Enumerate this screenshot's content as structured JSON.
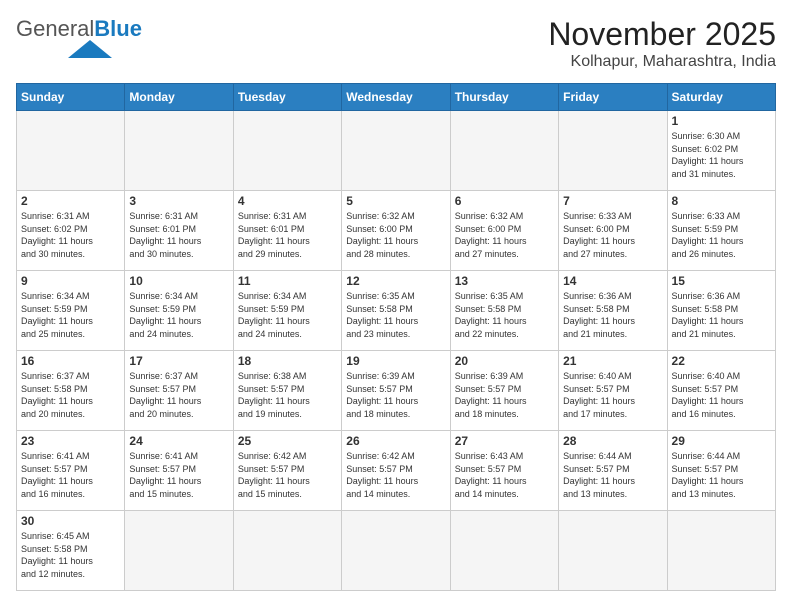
{
  "header": {
    "logo_general": "General",
    "logo_blue": "Blue",
    "month_title": "November 2025",
    "location": "Kolhapur, Maharashtra, India"
  },
  "weekdays": [
    "Sunday",
    "Monday",
    "Tuesday",
    "Wednesday",
    "Thursday",
    "Friday",
    "Saturday"
  ],
  "rows": [
    [
      {
        "day": "",
        "content": ""
      },
      {
        "day": "",
        "content": ""
      },
      {
        "day": "",
        "content": ""
      },
      {
        "day": "",
        "content": ""
      },
      {
        "day": "",
        "content": ""
      },
      {
        "day": "",
        "content": ""
      },
      {
        "day": "1",
        "content": "Sunrise: 6:30 AM\nSunset: 6:02 PM\nDaylight: 11 hours\nand 31 minutes."
      }
    ],
    [
      {
        "day": "2",
        "content": "Sunrise: 6:31 AM\nSunset: 6:02 PM\nDaylight: 11 hours\nand 30 minutes."
      },
      {
        "day": "3",
        "content": "Sunrise: 6:31 AM\nSunset: 6:01 PM\nDaylight: 11 hours\nand 30 minutes."
      },
      {
        "day": "4",
        "content": "Sunrise: 6:31 AM\nSunset: 6:01 PM\nDaylight: 11 hours\nand 29 minutes."
      },
      {
        "day": "5",
        "content": "Sunrise: 6:32 AM\nSunset: 6:00 PM\nDaylight: 11 hours\nand 28 minutes."
      },
      {
        "day": "6",
        "content": "Sunrise: 6:32 AM\nSunset: 6:00 PM\nDaylight: 11 hours\nand 27 minutes."
      },
      {
        "day": "7",
        "content": "Sunrise: 6:33 AM\nSunset: 6:00 PM\nDaylight: 11 hours\nand 27 minutes."
      },
      {
        "day": "8",
        "content": "Sunrise: 6:33 AM\nSunset: 5:59 PM\nDaylight: 11 hours\nand 26 minutes."
      }
    ],
    [
      {
        "day": "9",
        "content": "Sunrise: 6:34 AM\nSunset: 5:59 PM\nDaylight: 11 hours\nand 25 minutes."
      },
      {
        "day": "10",
        "content": "Sunrise: 6:34 AM\nSunset: 5:59 PM\nDaylight: 11 hours\nand 24 minutes."
      },
      {
        "day": "11",
        "content": "Sunrise: 6:34 AM\nSunset: 5:59 PM\nDaylight: 11 hours\nand 24 minutes."
      },
      {
        "day": "12",
        "content": "Sunrise: 6:35 AM\nSunset: 5:58 PM\nDaylight: 11 hours\nand 23 minutes."
      },
      {
        "day": "13",
        "content": "Sunrise: 6:35 AM\nSunset: 5:58 PM\nDaylight: 11 hours\nand 22 minutes."
      },
      {
        "day": "14",
        "content": "Sunrise: 6:36 AM\nSunset: 5:58 PM\nDaylight: 11 hours\nand 21 minutes."
      },
      {
        "day": "15",
        "content": "Sunrise: 6:36 AM\nSunset: 5:58 PM\nDaylight: 11 hours\nand 21 minutes."
      }
    ],
    [
      {
        "day": "16",
        "content": "Sunrise: 6:37 AM\nSunset: 5:58 PM\nDaylight: 11 hours\nand 20 minutes."
      },
      {
        "day": "17",
        "content": "Sunrise: 6:37 AM\nSunset: 5:57 PM\nDaylight: 11 hours\nand 20 minutes."
      },
      {
        "day": "18",
        "content": "Sunrise: 6:38 AM\nSunset: 5:57 PM\nDaylight: 11 hours\nand 19 minutes."
      },
      {
        "day": "19",
        "content": "Sunrise: 6:39 AM\nSunset: 5:57 PM\nDaylight: 11 hours\nand 18 minutes."
      },
      {
        "day": "20",
        "content": "Sunrise: 6:39 AM\nSunset: 5:57 PM\nDaylight: 11 hours\nand 18 minutes."
      },
      {
        "day": "21",
        "content": "Sunrise: 6:40 AM\nSunset: 5:57 PM\nDaylight: 11 hours\nand 17 minutes."
      },
      {
        "day": "22",
        "content": "Sunrise: 6:40 AM\nSunset: 5:57 PM\nDaylight: 11 hours\nand 16 minutes."
      }
    ],
    [
      {
        "day": "23",
        "content": "Sunrise: 6:41 AM\nSunset: 5:57 PM\nDaylight: 11 hours\nand 16 minutes."
      },
      {
        "day": "24",
        "content": "Sunrise: 6:41 AM\nSunset: 5:57 PM\nDaylight: 11 hours\nand 15 minutes."
      },
      {
        "day": "25",
        "content": "Sunrise: 6:42 AM\nSunset: 5:57 PM\nDaylight: 11 hours\nand 15 minutes."
      },
      {
        "day": "26",
        "content": "Sunrise: 6:42 AM\nSunset: 5:57 PM\nDaylight: 11 hours\nand 14 minutes."
      },
      {
        "day": "27",
        "content": "Sunrise: 6:43 AM\nSunset: 5:57 PM\nDaylight: 11 hours\nand 14 minutes."
      },
      {
        "day": "28",
        "content": "Sunrise: 6:44 AM\nSunset: 5:57 PM\nDaylight: 11 hours\nand 13 minutes."
      },
      {
        "day": "29",
        "content": "Sunrise: 6:44 AM\nSunset: 5:57 PM\nDaylight: 11 hours\nand 13 minutes."
      }
    ],
    [
      {
        "day": "30",
        "content": "Sunrise: 6:45 AM\nSunset: 5:58 PM\nDaylight: 11 hours\nand 12 minutes."
      },
      {
        "day": "",
        "content": ""
      },
      {
        "day": "",
        "content": ""
      },
      {
        "day": "",
        "content": ""
      },
      {
        "day": "",
        "content": ""
      },
      {
        "day": "",
        "content": ""
      },
      {
        "day": "",
        "content": ""
      }
    ]
  ]
}
